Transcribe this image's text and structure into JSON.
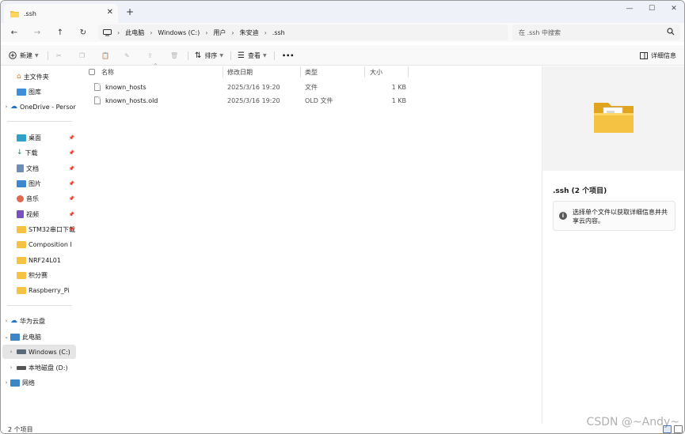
{
  "tab": {
    "title": ".ssh",
    "close": "✕"
  },
  "newtab": "+",
  "window_controls": {
    "minimize": "—",
    "maximize": "☐",
    "close": "✕"
  },
  "nav": {
    "back": "←",
    "forward": "→",
    "up": "↑",
    "refresh": "↻"
  },
  "breadcrumb": [
    "此电脑",
    "Windows (C:)",
    "用户",
    "朱安迪",
    ".ssh"
  ],
  "search": {
    "placeholder": "在 .ssh 中搜索"
  },
  "toolbar": {
    "new_label": "新建",
    "sort_label": "排序",
    "view_label": "查看",
    "more_label": "•••",
    "details_label": "详细信息"
  },
  "sidebar": {
    "home": "主文件夹",
    "gallery": "图库",
    "onedrive": "OneDrive - Persor",
    "desktop": "桌面",
    "downloads": "下载",
    "documents": "文档",
    "pictures": "图片",
    "music": "音乐",
    "videos": "视频",
    "stm32": "STM32串口下载",
    "composition": "Composition I",
    "nrf": "NRF24L01",
    "points": "积分赛",
    "raspberry": "Raspberry_Pi",
    "huawei": "华为云盘",
    "thispc": "此电脑",
    "c_drive": "Windows (C:)",
    "d_drive": "本地磁盘 (D:)",
    "network": "网络"
  },
  "columns": {
    "name": "名称",
    "modified": "修改日期",
    "type": "类型",
    "size": "大小"
  },
  "files": [
    {
      "name": "known_hosts",
      "modified": "2025/3/16 19:20",
      "type": "文件",
      "size": "1 KB"
    },
    {
      "name": "known_hosts.old",
      "modified": "2025/3/16 19:20",
      "type": "OLD 文件",
      "size": "1 KB"
    }
  ],
  "details": {
    "title": ".ssh (2 个项目)",
    "info": "选择单个文件以获取详细信息并共享云内容。"
  },
  "status": {
    "count": "2 个项目"
  },
  "watermark": "CSDN @~Andy~",
  "colors": {
    "folder": "#f6c244",
    "folder_dark": "#e0a41f",
    "accent": "#0a62c5"
  }
}
